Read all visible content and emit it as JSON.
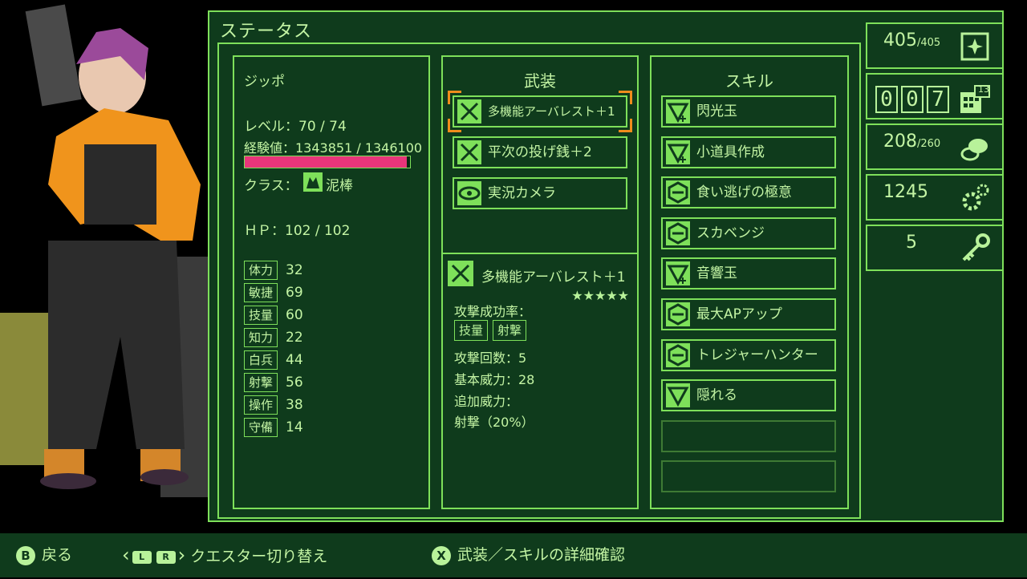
{
  "screen_title": "ステータス",
  "character": {
    "name": "ジッポ",
    "level_text": "レベル：70 / 74",
    "exp_text": "経験値：1343851 / 1346100",
    "exp_fraction": 0.983,
    "class_label": "クラス：",
    "class_name": "泥棒",
    "hp_text": "ＨＰ：102 / 102",
    "stats": [
      {
        "name": "体力",
        "value": "32"
      },
      {
        "name": "敏捷",
        "value": "69"
      },
      {
        "name": "技量",
        "value": "60"
      },
      {
        "name": "知力",
        "value": "22"
      },
      {
        "name": "白兵",
        "value": "44"
      },
      {
        "name": "射撃",
        "value": "56"
      },
      {
        "name": "操作",
        "value": "38"
      },
      {
        "name": "守備",
        "value": "14"
      }
    ]
  },
  "equipment": {
    "heading": "武装",
    "items": [
      {
        "label": "多機能アーバレスト＋1",
        "icon": "crossed-swords-icon",
        "selected": true
      },
      {
        "label": "平次の投げ銭＋2",
        "icon": "crossed-swords-icon",
        "selected": false
      },
      {
        "label": "実況カメラ",
        "icon": "eye-icon",
        "selected": false
      }
    ],
    "detail": {
      "name": "多機能アーバレスト＋1",
      "stars": "★★★★★",
      "hit_rate_label": "攻撃成功率：",
      "hit_rate_stats": [
        "技量",
        "射撃"
      ],
      "attack_count": "攻撃回数：5",
      "base_power": "基本威力：28",
      "extra_power_label": "追加威力：",
      "extra_power_value": "射撃（20%）"
    }
  },
  "skills": {
    "heading": "スキル",
    "items": [
      {
        "label": "閃光玉",
        "icon": "triangle-plus-icon"
      },
      {
        "label": "小道具作成",
        "icon": "triangle-plus-icon"
      },
      {
        "label": "食い逃げの極意",
        "icon": "hexagon-icon"
      },
      {
        "label": "スカベンジ",
        "icon": "hexagon-icon"
      },
      {
        "label": "音響玉",
        "icon": "triangle-plus-icon"
      },
      {
        "label": "最大APアップ",
        "icon": "hexagon-icon"
      },
      {
        "label": "トレジャーハンター",
        "icon": "hexagon-icon"
      },
      {
        "label": "隠れる",
        "icon": "triangle-icon"
      }
    ],
    "empty_slots": 2
  },
  "sidebar": {
    "ap": {
      "value": "405",
      "max": "/405",
      "icon": "sparkle-card-icon"
    },
    "day_counter": {
      "digits": [
        "0",
        "0",
        "7"
      ],
      "badge": "13",
      "icon": "calendar-icon"
    },
    "food": {
      "value": "208",
      "max": "/260",
      "icon": "food-icon"
    },
    "parts": {
      "value": "1245",
      "icon": "gears-icon"
    },
    "keys": {
      "value": "5",
      "icon": "key-icon"
    }
  },
  "footer": {
    "back_button": "B",
    "back_label": "戻る",
    "switch_l": "L",
    "switch_r": "R",
    "switch_label": "クエスター切り替え",
    "detail_button": "X",
    "detail_label": "武装／スキルの詳細確認"
  },
  "colors": {
    "panel_bg": "#0f3b1c",
    "border": "#7ee05a",
    "text": "#c4f5a4",
    "exp_bar": "#e8357a",
    "selection": "#f08c1c"
  }
}
